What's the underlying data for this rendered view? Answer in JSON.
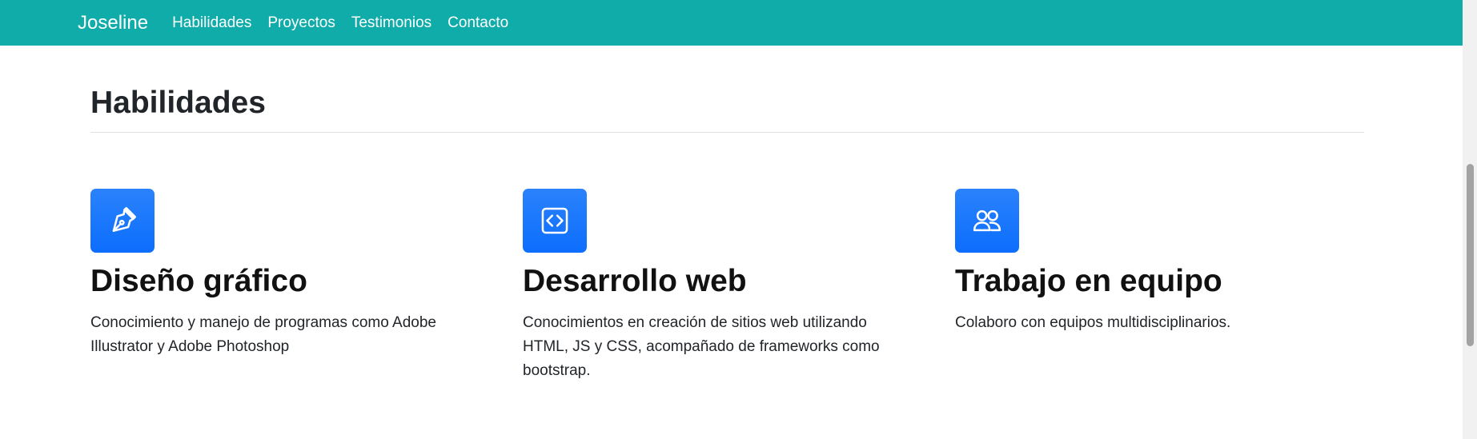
{
  "navbar": {
    "brand": "Joseline",
    "links": [
      "Habilidades",
      "Proyectos",
      "Testimonios",
      "Contacto"
    ],
    "background_color": "#10aca9"
  },
  "section": {
    "title": "Habilidades"
  },
  "features": [
    {
      "icon": "pen-icon",
      "title": "Diseño gráfico",
      "text": "Conocimiento y manejo de programas como Adobe Illustrator y Adobe Photoshop"
    },
    {
      "icon": "code-icon",
      "title": "Desarrollo web",
      "text": "Conocimientos en creación de sitios web utilizando HTML, JS y CSS, acompañado de frameworks como bootstrap."
    },
    {
      "icon": "people-icon",
      "title": "Trabajo en equipo",
      "text": "Colaboro con equipos multidisciplinarios."
    }
  ],
  "accent_color": "#0d6efd"
}
